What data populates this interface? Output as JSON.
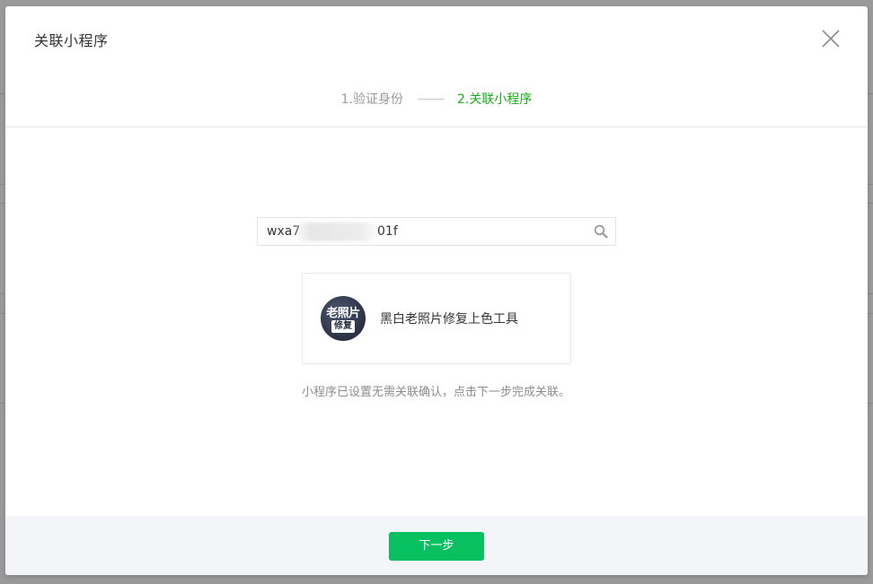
{
  "dialog": {
    "title": "关联小程序",
    "close_icon": "close-icon"
  },
  "steps": [
    {
      "label": "1.验证身份",
      "state": "done"
    },
    {
      "label": "2.关联小程序",
      "state": "active"
    }
  ],
  "search": {
    "value_prefix": "wxa7",
    "value_suffix": "01f",
    "icon": "search-icon"
  },
  "result": {
    "avatar_text_top": "老照片",
    "avatar_text_bottom": "修复",
    "name": "黑白老照片修复上色工具"
  },
  "hint": "小程序已设置无需关联确认，点击下一步完成关联。",
  "footer": {
    "next_label": "下一步"
  },
  "colors": {
    "accent": "#1aad19",
    "primary_button": "#07c160",
    "footer_bg": "#f4f5f9",
    "overlay": "#8f8f8f"
  }
}
